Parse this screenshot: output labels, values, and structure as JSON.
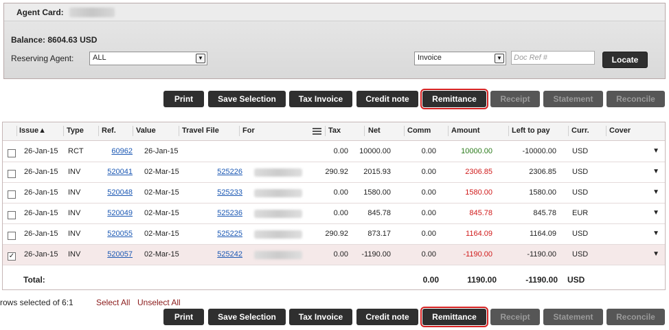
{
  "header": {
    "agent_label": "Agent Card:",
    "balance": "Balance: 8604.63 USD",
    "reserving_label": "Reserving Agent:",
    "reserving_value": "ALL",
    "doc_type_value": "Invoice",
    "doc_ref_placeholder": "Doc Ref #",
    "locate_label": "Locate"
  },
  "toolbar": {
    "print": "Print",
    "save_selection": "Save Selection",
    "tax_invoice": "Tax Invoice",
    "credit_note": "Credit note",
    "remittance": "Remittance",
    "receipt": "Receipt",
    "statement": "Statement",
    "reconcile": "Reconcile"
  },
  "table": {
    "headers": {
      "issue": "Issue▲",
      "type": "Type",
      "ref": "Ref.",
      "value": "Value",
      "travel_file": "Travel File",
      "for": "For",
      "tax": "Tax",
      "net": "Net",
      "comm": "Comm",
      "amount": "Amount",
      "left_to_pay": "Left to pay",
      "curr": "Curr.",
      "cover": "Cover"
    },
    "rows": [
      {
        "checked": false,
        "issue": "26-Jan-15",
        "type": "RCT",
        "ref": "60962",
        "value": "26-Jan-15",
        "travel_file": "",
        "tax": "0.00",
        "net": "10000.00",
        "comm": "0.00",
        "amount": "10000.00",
        "left_to_pay": "-10000.00",
        "curr": "USD"
      },
      {
        "checked": false,
        "issue": "26-Jan-15",
        "type": "INV",
        "ref": "520041",
        "value": "02-Mar-15",
        "travel_file": "525226",
        "tax": "290.92",
        "net": "2015.93",
        "comm": "0.00",
        "amount": "2306.85",
        "left_to_pay": "2306.85",
        "curr": "USD"
      },
      {
        "checked": false,
        "issue": "26-Jan-15",
        "type": "INV",
        "ref": "520048",
        "value": "02-Mar-15",
        "travel_file": "525233",
        "tax": "0.00",
        "net": "1580.00",
        "comm": "0.00",
        "amount": "1580.00",
        "left_to_pay": "1580.00",
        "curr": "USD"
      },
      {
        "checked": false,
        "issue": "26-Jan-15",
        "type": "INV",
        "ref": "520049",
        "value": "02-Mar-15",
        "travel_file": "525236",
        "tax": "0.00",
        "net": "845.78",
        "comm": "0.00",
        "amount": "845.78",
        "left_to_pay": "845.78",
        "curr": "EUR"
      },
      {
        "checked": false,
        "issue": "26-Jan-15",
        "type": "INV",
        "ref": "520055",
        "value": "02-Mar-15",
        "travel_file": "525225",
        "tax": "290.92",
        "net": "873.17",
        "comm": "0.00",
        "amount": "1164.09",
        "left_to_pay": "1164.09",
        "curr": "USD"
      },
      {
        "checked": true,
        "issue": "26-Jan-15",
        "type": "INV",
        "ref": "520057",
        "value": "02-Mar-15",
        "travel_file": "525242",
        "tax": "0.00",
        "net": "-1190.00",
        "comm": "0.00",
        "amount": "-1190.00",
        "left_to_pay": "-1190.00",
        "curr": "USD"
      }
    ],
    "totals": {
      "label": "Total:",
      "comm": "0.00",
      "amount": "1190.00",
      "left_to_pay": "-1190.00",
      "curr": "USD"
    }
  },
  "footer": {
    "rows_selected": "rows selected of 6:1",
    "select_all": "Select All",
    "unselect_all": "Unselect All"
  },
  "colors": {
    "positive_amount": "#2a7a1a",
    "negative_amount": "#d01a1a",
    "button_bg": "#2f2f2f",
    "highlight": "#d41f1f"
  }
}
